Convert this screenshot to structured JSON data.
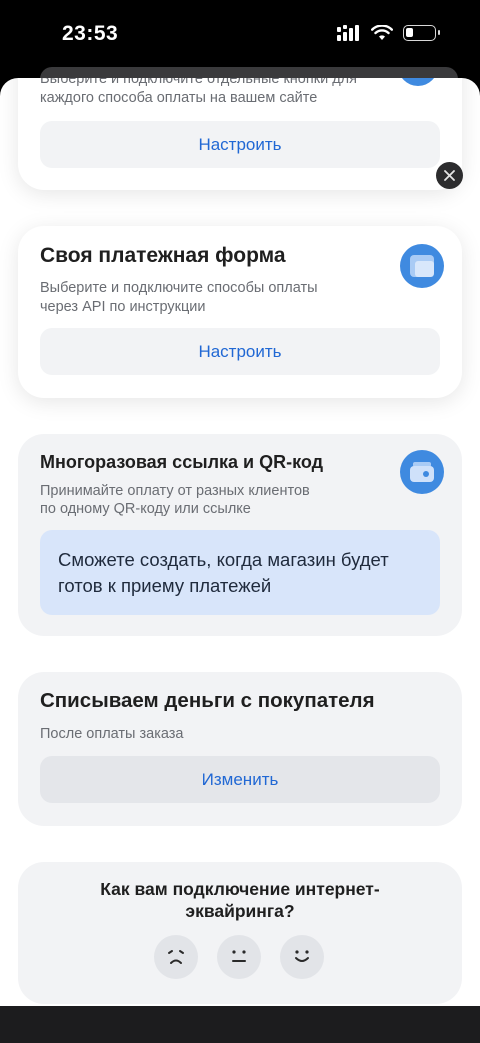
{
  "status_bar": {
    "time": "23:53"
  },
  "cards": {
    "buttons_card": {
      "description_line1": "Выберите и подключите отдельные кнопки для",
      "description_line2": "каждого способа оплаты на вашем сайте",
      "button_label": "Настроить"
    },
    "custom_form": {
      "title": "Своя платежная форма",
      "description_line1": "Выберите и подключите способы оплаты",
      "description_line2": "через API по инструкции",
      "button_label": "Настроить",
      "icon": "browser-window-icon"
    },
    "reusable_link": {
      "title": "Многоразовая ссылка и QR-код",
      "description_line1": "Принимайте оплату от разных клиентов",
      "description_line2": "по одному QR-коду или ссылке",
      "notice_line1": "Сможете создать, когда магазин будет",
      "notice_line2": "готов к приему платежей",
      "icon": "payment-card-icon"
    },
    "charge_timing": {
      "title": "Списываем деньги с покупателя",
      "description": "После оплаты заказа",
      "button_label": "Изменить"
    },
    "feedback": {
      "title_line1": "Как вам подключение интернет-",
      "title_line2": "эквайринга?",
      "options": [
        "sad-face-icon",
        "neutral-face-icon",
        "happy-face-icon"
      ]
    }
  },
  "colors": {
    "accent_blue": "#3f8ae0",
    "link_blue": "#2168d4",
    "notice_bg": "#d8e5fa"
  }
}
